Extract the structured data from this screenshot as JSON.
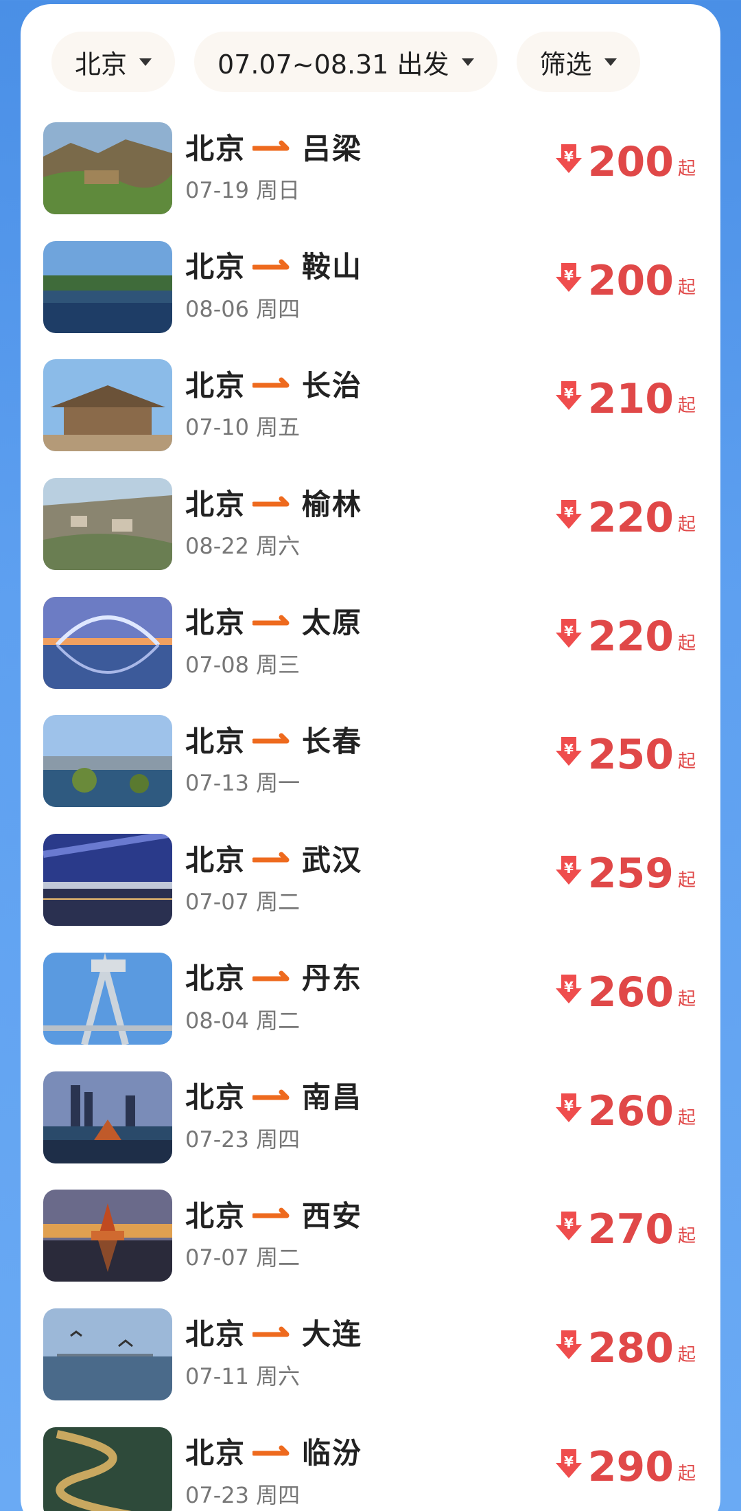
{
  "filters": {
    "city": "北京",
    "date_range": "07.07~08.31 出发",
    "filter": "筛选"
  },
  "colors": {
    "price": "#e04848",
    "arrow": "#ee6a1e",
    "background": "#5ea0f0"
  },
  "suffix": "起",
  "flights": [
    {
      "from": "北京",
      "to": "吕梁",
      "date": "07-19 周日",
      "price": "200",
      "thumb": "mountain-village"
    },
    {
      "from": "北京",
      "to": "鞍山",
      "date": "08-06 周四",
      "price": "200",
      "thumb": "lake-reflection"
    },
    {
      "from": "北京",
      "to": "长治",
      "date": "07-10 周五",
      "price": "210",
      "thumb": "temple-roof"
    },
    {
      "from": "北京",
      "to": "榆林",
      "date": "08-22 周六",
      "price": "220",
      "thumb": "hillside-town"
    },
    {
      "from": "北京",
      "to": "太原",
      "date": "07-08 周三",
      "price": "220",
      "thumb": "arch-bridge-sunset"
    },
    {
      "from": "北京",
      "to": "长春",
      "date": "07-13 周一",
      "price": "250",
      "thumb": "river-park"
    },
    {
      "from": "北京",
      "to": "武汉",
      "date": "07-07 周二",
      "price": "259",
      "thumb": "yangtze-bridge"
    },
    {
      "from": "北京",
      "to": "丹东",
      "date": "08-04 周二",
      "price": "260",
      "thumb": "steel-bridge"
    },
    {
      "from": "北京",
      "to": "南昌",
      "date": "07-23 周四",
      "price": "260",
      "thumb": "city-skyline-pavilion"
    },
    {
      "from": "北京",
      "to": "西安",
      "date": "07-07 周二",
      "price": "270",
      "thumb": "pagoda-night"
    },
    {
      "from": "北京",
      "to": "大连",
      "date": "07-11 周六",
      "price": "280",
      "thumb": "seagulls-sea"
    },
    {
      "from": "北京",
      "to": "临汾",
      "date": "07-23 周四",
      "price": "290",
      "thumb": "river-bend-aerial"
    }
  ]
}
